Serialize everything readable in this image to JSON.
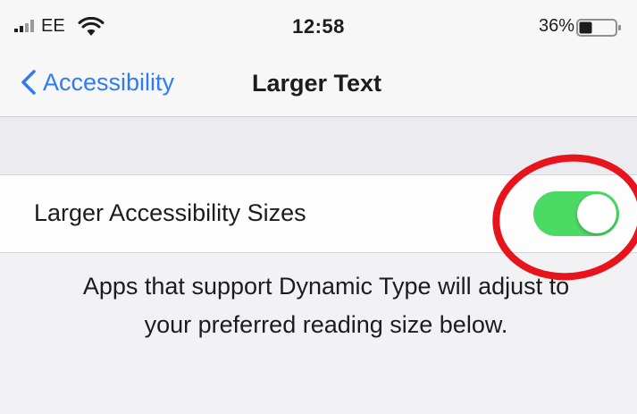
{
  "status_bar": {
    "carrier": "EE",
    "time": "12:58",
    "battery_percent": "36%",
    "battery_level": 0.36,
    "signal_icon": "cellular-signal",
    "wifi_icon": "wifi",
    "battery_icon": "battery"
  },
  "nav": {
    "back_label": "Accessibility",
    "back_icon": "chevron-left",
    "title": "Larger Text"
  },
  "setting": {
    "label": "Larger Accessibility Sizes",
    "toggle_on": true,
    "toggle_color": "#4cd964"
  },
  "footer": {
    "note": "Apps that support Dynamic Type will adjust to your preferred reading size below."
  },
  "annotation": {
    "shape": "circle",
    "color": "#e8141b"
  },
  "colors": {
    "accent": "#2f7bf5",
    "background": "#f2f2f4"
  }
}
